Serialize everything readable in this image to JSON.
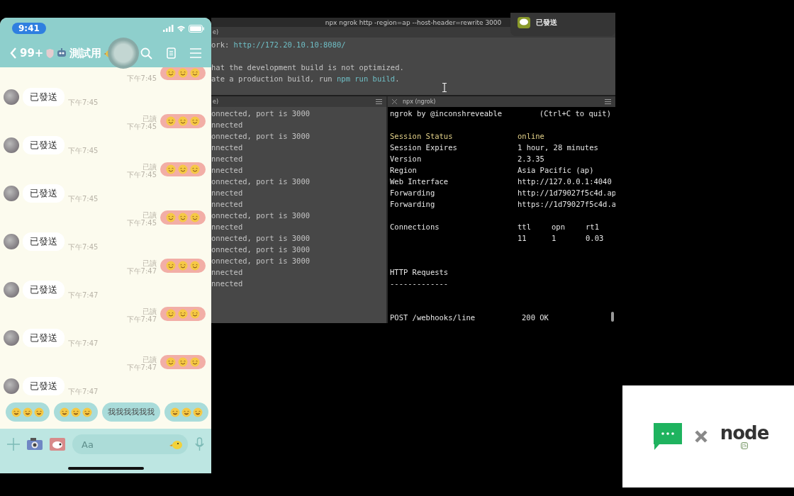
{
  "phone": {
    "status_bar": {
      "time": "9:41"
    },
    "header": {
      "unread": "99+",
      "title": "測試用"
    },
    "messages": [
      {
        "kind": "outgoing",
        "time": "下午7:45"
      },
      {
        "kind": "incoming",
        "text": "已發送",
        "time": "下午7:45"
      },
      {
        "kind": "outgoing",
        "read": "已讀",
        "time": "下午7:45"
      },
      {
        "kind": "incoming",
        "text": "已發送",
        "time": "下午7:45"
      },
      {
        "kind": "outgoing",
        "read": "已讀",
        "time": "下午7:45"
      },
      {
        "kind": "incoming",
        "text": "已發送",
        "time": "下午7:45"
      },
      {
        "kind": "outgoing",
        "read": "已讀",
        "time": "下午7:45"
      },
      {
        "kind": "incoming",
        "text": "已發送",
        "time": "下午7:45"
      },
      {
        "kind": "outgoing",
        "read": "已讀",
        "time": "下午7:47"
      },
      {
        "kind": "incoming",
        "text": "已發送",
        "time": "下午7:47"
      },
      {
        "kind": "outgoing",
        "read": "已讀",
        "time": "下午7:47"
      },
      {
        "kind": "incoming",
        "text": "已發送",
        "time": "下午7:47"
      },
      {
        "kind": "outgoing",
        "read": "已讀",
        "time": "下午7:47"
      },
      {
        "kind": "incoming",
        "text": "已發送",
        "time": "下午7:47"
      }
    ],
    "quick_replies": [
      {
        "kind": "emoji"
      },
      {
        "kind": "emoji"
      },
      {
        "kind": "text",
        "text": "我我我我我我"
      },
      {
        "kind": "emoji"
      }
    ],
    "input": {
      "placeholder": "Aa"
    }
  },
  "terminal": {
    "title": "npx ngrok http -region=ap --host-header=rewrite 3000",
    "notification": {
      "text": "已發送"
    },
    "top_pane": {
      "tab": "e)",
      "lines": [
        {
          "parts": [
            {
              "text": "ork: "
            },
            {
              "text": "http://172.20.10.10:8080/",
              "highlight": true
            }
          ],
          "space_before": false
        },
        {
          "parts": [
            {
              "text": "hat the development build is not optimized."
            }
          ],
          "space_before": true
        },
        {
          "parts": [
            {
              "text": "ate a production build, run "
            },
            {
              "text": "npm run build",
              "highlight": true
            },
            {
              "text": "."
            }
          ],
          "space_before": false
        }
      ]
    },
    "left_pane": {
      "tab": "e)",
      "lines": [
        "onnected, port is 3000",
        "nnected",
        "onnected, port is 3000",
        "nnected",
        "nnected",
        "nnected",
        "onnected, port is 3000",
        "nnected",
        "nnected",
        "onnected, port is 3000",
        "nnected",
        "onnected, port is 3000",
        "onnected, port is 3000",
        "onnected, port is 3000",
        "nnected",
        "nnected"
      ]
    },
    "ngrok_pane": {
      "tab": "npx (ngrok)",
      "banner": "ngrok by @inconshreveable",
      "quit_hint": "(Ctrl+C to quit)",
      "rows": [
        {
          "label": "Session Status",
          "value": "online",
          "highlight": true
        },
        {
          "label": "Session Expires",
          "value": "1 hour, 28 minutes",
          "highlight": false
        },
        {
          "label": "Version",
          "value": "2.3.35",
          "highlight": false
        },
        {
          "label": "Region",
          "value": "Asia Pacific (ap)",
          "highlight": false
        },
        {
          "label": "Web Interface",
          "value": "http://127.0.0.1:4040",
          "highlight": false
        },
        {
          "label": "Forwarding",
          "value": "http://1d79027f5c4d.ap",
          "highlight": false
        },
        {
          "label": "Forwarding",
          "value": "https://1d79027f5c4d.a",
          "highlight": false
        }
      ],
      "connections": {
        "label": "Connections",
        "headers": [
          "ttl",
          "opn",
          "rt1"
        ],
        "values": [
          "11",
          "1",
          "0.03"
        ]
      },
      "requests_title": "HTTP Requests",
      "requests_rule": "-------------",
      "requests": [
        {
          "method_path": "POST /webhooks/line",
          "status": "200 OK"
        }
      ]
    }
  },
  "logo_card": {
    "wordmark": "node",
    "badge": "JS"
  }
}
